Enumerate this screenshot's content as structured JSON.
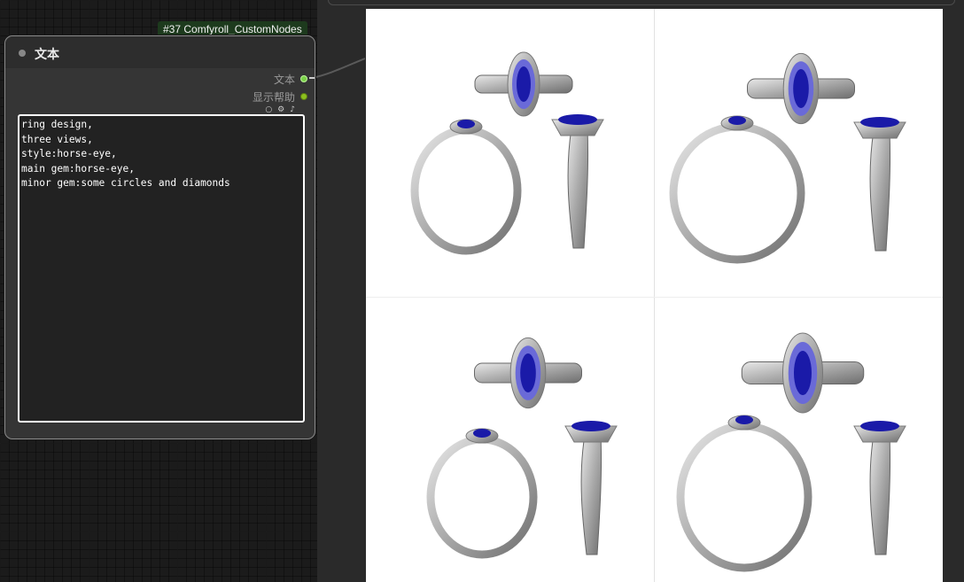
{
  "node": {
    "badge": "#37 Comfyroll_CustomNodes",
    "title": "文本",
    "outputs": [
      {
        "label": "文本"
      },
      {
        "label": "显示帮助"
      }
    ],
    "icons": [
      "circle-icon",
      "settings-icon",
      "sound-icon"
    ],
    "text_lines": [
      "ring design,",
      "three views,",
      "style:horse-eye,",
      "main gem:horse-eye,",
      "minor gem:some circles and diamonds"
    ]
  },
  "preview": {
    "subject": "ring three-view renders",
    "gem_color": "#1a1aa8",
    "metal_color": "#a9a9a9"
  }
}
